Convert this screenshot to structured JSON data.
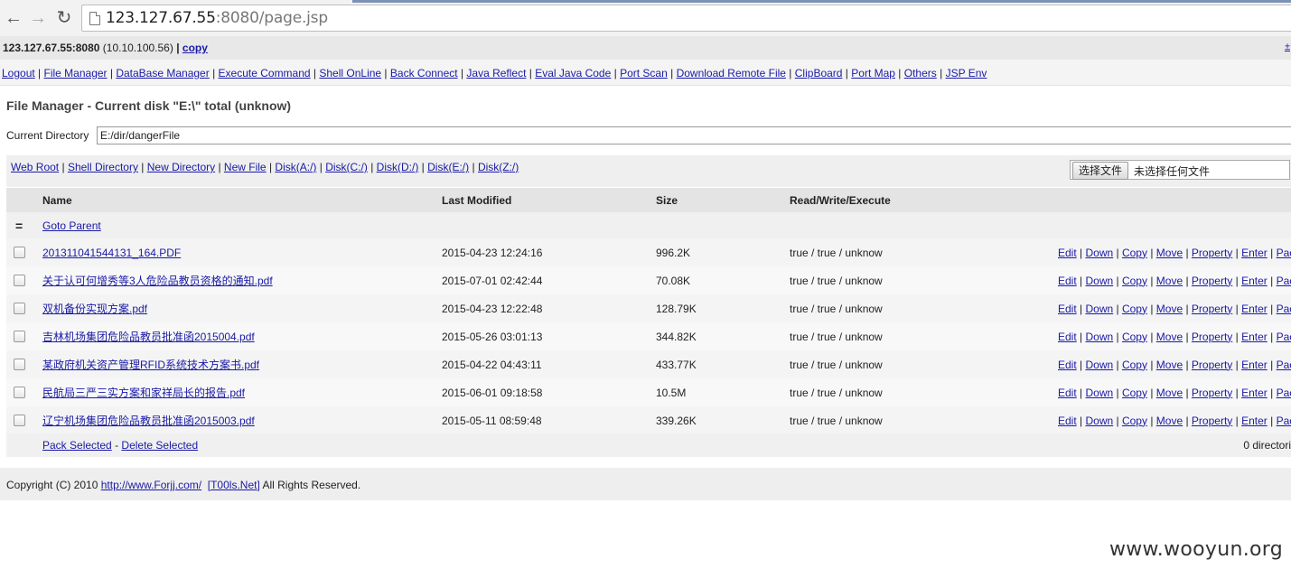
{
  "browser": {
    "url_host": "123.127.67.55",
    "url_rest": ":8080/page.jsp"
  },
  "info": {
    "host": "123.127.67.55:8080",
    "ip": "(10.10.100.56)",
    "sep": "|",
    "copy": "copy",
    "right_link": "±"
  },
  "menu": [
    "Logout",
    "File Manager",
    "DataBase Manager",
    "Execute Command",
    "Shell OnLine",
    "Back Connect",
    "Java Reflect",
    "Eval Java Code",
    "Port Scan",
    "Download Remote File",
    "ClipBoard",
    "Port Map",
    "Others",
    "JSP Env"
  ],
  "title": "File Manager - Current disk \"E:\\\" total (unknow)",
  "current_dir": {
    "label": "Current Directory",
    "value": "E:/dir/dangerFile"
  },
  "toolbar": {
    "links": [
      "Web Root",
      "Shell Directory",
      "New Directory",
      "New File",
      "Disk(A:/)",
      "Disk(C:/)",
      "Disk(D:/)",
      "Disk(E:/)",
      "Disk(Z:/)"
    ],
    "choose_button": "选择文件",
    "no_file": "未选择任何文件"
  },
  "table": {
    "headers": {
      "name": "Name",
      "modified": "Last Modified",
      "size": "Size",
      "rwx": "Read/Write/Execute"
    },
    "parent_symbol": "=",
    "parent_link": "Goto Parent",
    "actions": [
      "Edit",
      "Down",
      "Copy",
      "Move",
      "Property",
      "Enter",
      "Pac"
    ],
    "rows": [
      {
        "name": "201311041544131_164.PDF",
        "modified": "2015-04-23 12:24:16",
        "size": "996.2K",
        "rwx": "true / true / unknow"
      },
      {
        "name": "关于认可何增秀等3人危险品教员资格的通知.pdf",
        "modified": "2015-07-01 02:42:44",
        "size": "70.08K",
        "rwx": "true / true / unknow"
      },
      {
        "name": "双机备份实现方案.pdf",
        "modified": "2015-04-23 12:22:48",
        "size": "128.79K",
        "rwx": "true / true / unknow"
      },
      {
        "name": "吉林机场集团危险品教员批准函2015004.pdf",
        "modified": "2015-05-26 03:01:13",
        "size": "344.82K",
        "rwx": "true / true / unknow"
      },
      {
        "name": "某政府机关资产管理RFID系统技术方案书.pdf",
        "modified": "2015-04-22 04:43:11",
        "size": "433.77K",
        "rwx": "true / true / unknow"
      },
      {
        "name": "民航局三严三实方案和家祥局长的报告.pdf",
        "modified": "2015-06-01 09:18:58",
        "size": "10.5M",
        "rwx": "true / true / unknow"
      },
      {
        "name": "辽宁机场集团危险品教员批准函2015003.pdf",
        "modified": "2015-05-11 08:59:48",
        "size": "339.26K",
        "rwx": "true / true / unknow"
      }
    ],
    "footer": {
      "pack": "Pack Selected",
      "sep": "-",
      "delete": "Delete Selected",
      "summary": "0 directori"
    }
  },
  "copyright": {
    "prefix": "Copyright (C) 2010",
    "link1": "http://www.Forjj.com/",
    "link2": "[T00ls.Net]",
    "suffix": "All Rights Reserved."
  },
  "watermark": "www.wooyun.org"
}
